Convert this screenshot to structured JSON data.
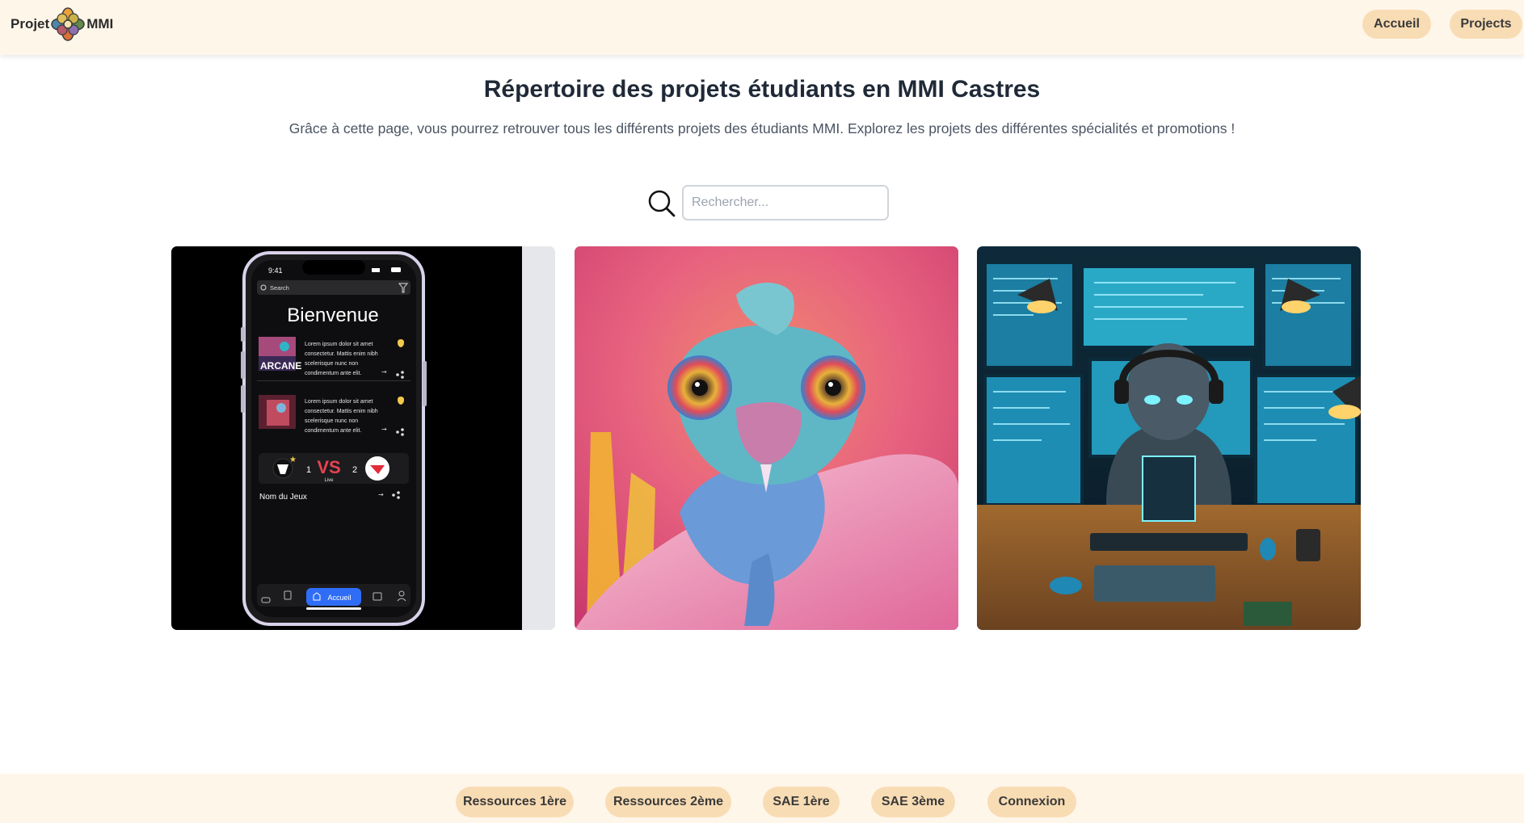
{
  "header": {
    "brand_left": "Projet",
    "brand_right": "MMI",
    "nav": [
      "Accueil",
      "Projects"
    ]
  },
  "main": {
    "title": "Répertoire des projets étudiants en MMI Castres",
    "subtitle": "Grâce à cette page, vous pourrez retrouver tous les différents projets des étudiants MMI. Explorez les projets des différentes spécialités et promotions !",
    "search_placeholder": "Rechercher...",
    "search_value": ""
  },
  "phone": {
    "time": "9:41",
    "search": "Search",
    "welcome": "Bienvenue",
    "news_text": [
      "Lorem ipsum dolor sit amet",
      "consectetur. Mattis enim nibh",
      "scelerisque nunc non",
      "condimentum ante elit."
    ],
    "thumb_label": "ARCANE",
    "score_left": "1",
    "score_right": "2",
    "vs": "VS",
    "live": "Live",
    "game_name": "Nom du Jeux",
    "tab_active": "Accueil"
  },
  "cards": [
    {
      "subject": "mobile-app-mockup"
    },
    {
      "subject": "chameleon-photo"
    },
    {
      "subject": "robot-coder-illustration"
    }
  ],
  "footer": {
    "links": [
      "Ressources 1ère",
      "Ressources 2ème",
      "SAE 1ère",
      "SAE 3ème",
      "Connexion"
    ]
  },
  "colors": {
    "header_bg": "#fff6ea",
    "pill_bg": "#f8dcb4",
    "title": "#1f2937",
    "accent_blue": "#2f6df6",
    "vs_red": "#e8434f"
  }
}
